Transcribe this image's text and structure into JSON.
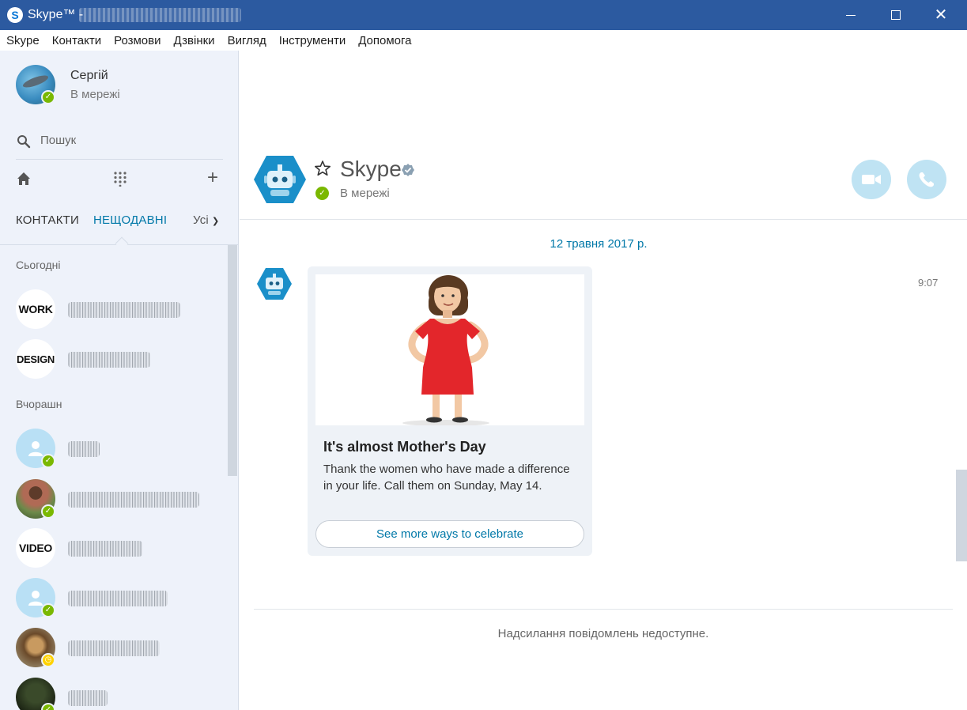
{
  "window": {
    "title": "Skype™ -",
    "controls": {
      "minimize": "minimize",
      "maximize": "maximize",
      "close": "close"
    }
  },
  "menu": [
    "Skype",
    "Контакти",
    "Розмови",
    "Дзвінки",
    "Вигляд",
    "Інструменти",
    "Допомога"
  ],
  "profile": {
    "name": "Сергій",
    "status": "В мережі"
  },
  "search": {
    "placeholder": "Пошук"
  },
  "tabs": {
    "contacts": "КОНТАКТИ",
    "recent": "НЕЩОДАВНІ",
    "filter": "Усі",
    "active": "recent"
  },
  "sections": {
    "today": "Сьогодні",
    "yesterday": "Вчорашн"
  },
  "contacts_today": [
    {
      "avatar_text": "WORK"
    },
    {
      "avatar_text": "DESIGN"
    }
  ],
  "contacts_yesterday": [
    {
      "avatar_text": "",
      "status": "online"
    },
    {
      "avatar_text": "",
      "status": "online"
    },
    {
      "avatar_text": "VIDEO"
    },
    {
      "avatar_text": "",
      "status": "online"
    },
    {
      "avatar_text": "",
      "status": "away"
    },
    {
      "avatar_text": "",
      "status": "online"
    }
  ],
  "conversation": {
    "name": "Skype",
    "status": "В мережі",
    "date": "12 травня 2017 р.",
    "time": "9:07",
    "card": {
      "title": "It's almost Mother's Day",
      "body": "Thank the women who have made a difference in your life. Call them on Sunday, May 14.",
      "button": "See more ways to celebrate"
    },
    "footer": "Надсилання повідомлень недоступне."
  },
  "colors": {
    "titlebar": "#2c5aa0",
    "accent": "#0078a8",
    "online": "#7ab800",
    "away": "#ffd200",
    "sidebar": "#eef2fa"
  },
  "icons": [
    "skype-logo-icon",
    "search-icon",
    "home-icon",
    "dialpad-icon",
    "plus-icon",
    "chevron-down-icon",
    "star-icon",
    "verified-icon",
    "video-call-icon",
    "phone-icon",
    "bot-avatar-icon",
    "user-icon"
  ]
}
